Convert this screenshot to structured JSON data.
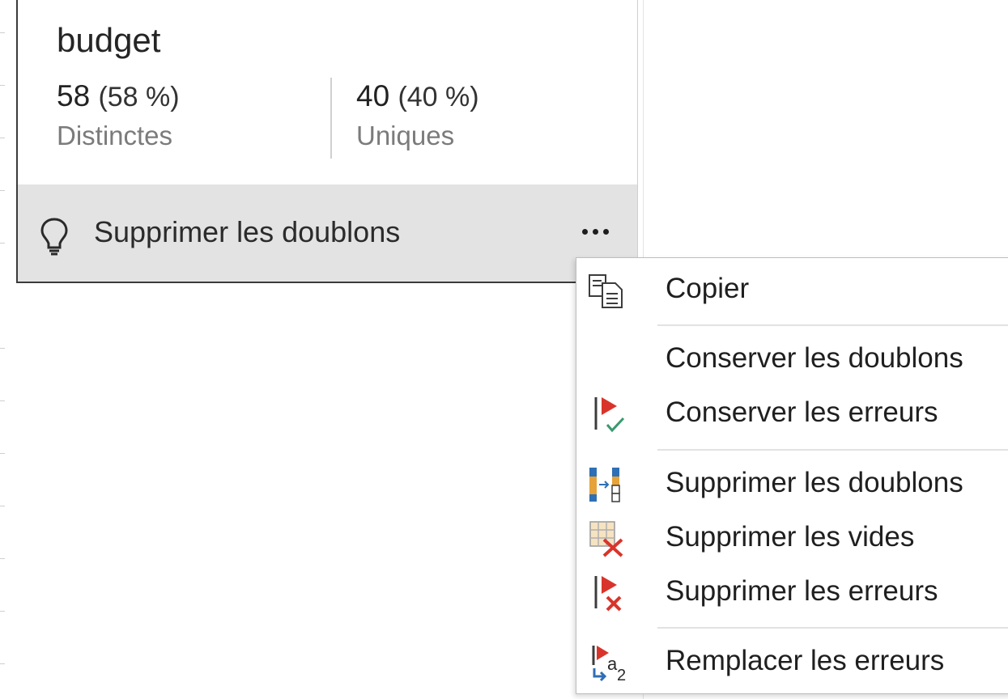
{
  "column": {
    "name": "budget",
    "distinct": {
      "count": "58",
      "percent": "(58 %)",
      "label": "Distinctes"
    },
    "unique": {
      "count": "40",
      "percent": "(40 %)",
      "label": "Uniques"
    },
    "suggestion": {
      "label": "Supprimer les doublons",
      "icon": "lightbulb-icon"
    },
    "more_icon": "ellipsis-icon"
  },
  "menu": {
    "items": [
      {
        "label": "Copier",
        "icon": "copy-icon"
      },
      {
        "label": "Conserver les doublons",
        "icon": ""
      },
      {
        "label": "Conserver les erreurs",
        "icon": "keep-errors-icon"
      },
      {
        "label": "Supprimer les doublons",
        "icon": "remove-duplicates-icon"
      },
      {
        "label": "Supprimer les vides",
        "icon": "remove-empty-icon"
      },
      {
        "label": "Supprimer les erreurs",
        "icon": "remove-errors-icon"
      },
      {
        "label": "Remplacer les erreurs",
        "icon": "replace-errors-icon"
      }
    ]
  },
  "colors": {
    "accent_red": "#d9342b",
    "accent_green": "#3a9a6e",
    "accent_blue": "#2e6fb5",
    "accent_orange": "#e5a33a"
  }
}
